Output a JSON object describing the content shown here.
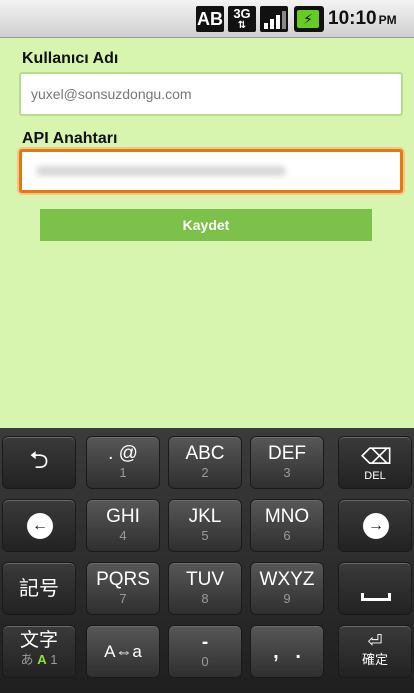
{
  "statusbar": {
    "ab_label": "AB",
    "network_label": "3G",
    "network_arrows": "⇅",
    "battery_icon": "⚡",
    "time": "10:10",
    "ampm": "PM"
  },
  "form": {
    "username_label": "Kullanıcı Adı",
    "username_value": "yuxel@sonsuzdongu.com",
    "api_key_label": "API Anahtarı",
    "save_button": "Kaydet"
  },
  "keyboard": {
    "rows": [
      {
        "keys": [
          "undo",
          ". @|1",
          "ABC|2",
          "DEF|3",
          "DEL"
        ]
      },
      {
        "keys": [
          "left",
          "GHI|4",
          "JKL|5",
          "MNO|6",
          "right"
        ]
      },
      {
        "keys": [
          "記号",
          "PQRS|7",
          "TUV|8",
          "WXYZ|9",
          "space"
        ]
      },
      {
        "keys": [
          "文字",
          "A⇔a",
          "-|0",
          ", .",
          "確定"
        ]
      }
    ],
    "undo_icon": "⮌",
    "del_icon": "⌫",
    "del_label": "DEL",
    "left_icon": "←",
    "right_icon": "→",
    "symbols_label": "記号",
    "kana_main": "文字",
    "kana_sub_a": "あ",
    "kana_sub_b": "A",
    "kana_sub_c": "1",
    "case_label": "A⇔a",
    "key_dot_at": ". @",
    "key_1": "1",
    "key_abc": "ABC",
    "key_2": "2",
    "key_def": "DEF",
    "key_3": "3",
    "key_ghi": "GHI",
    "key_4": "4",
    "key_jkl": "JKL",
    "key_5": "5",
    "key_mno": "MNO",
    "key_6": "6",
    "key_pqrs": "PQRS",
    "key_7": "7",
    "key_tuv": "TUV",
    "key_8": "8",
    "key_wxyz": "WXYZ",
    "key_9": "9",
    "key_dash": "-",
    "key_0": "0",
    "key_comma_period": ",   .",
    "enter_icon": "⏎",
    "enter_label": "確定"
  }
}
